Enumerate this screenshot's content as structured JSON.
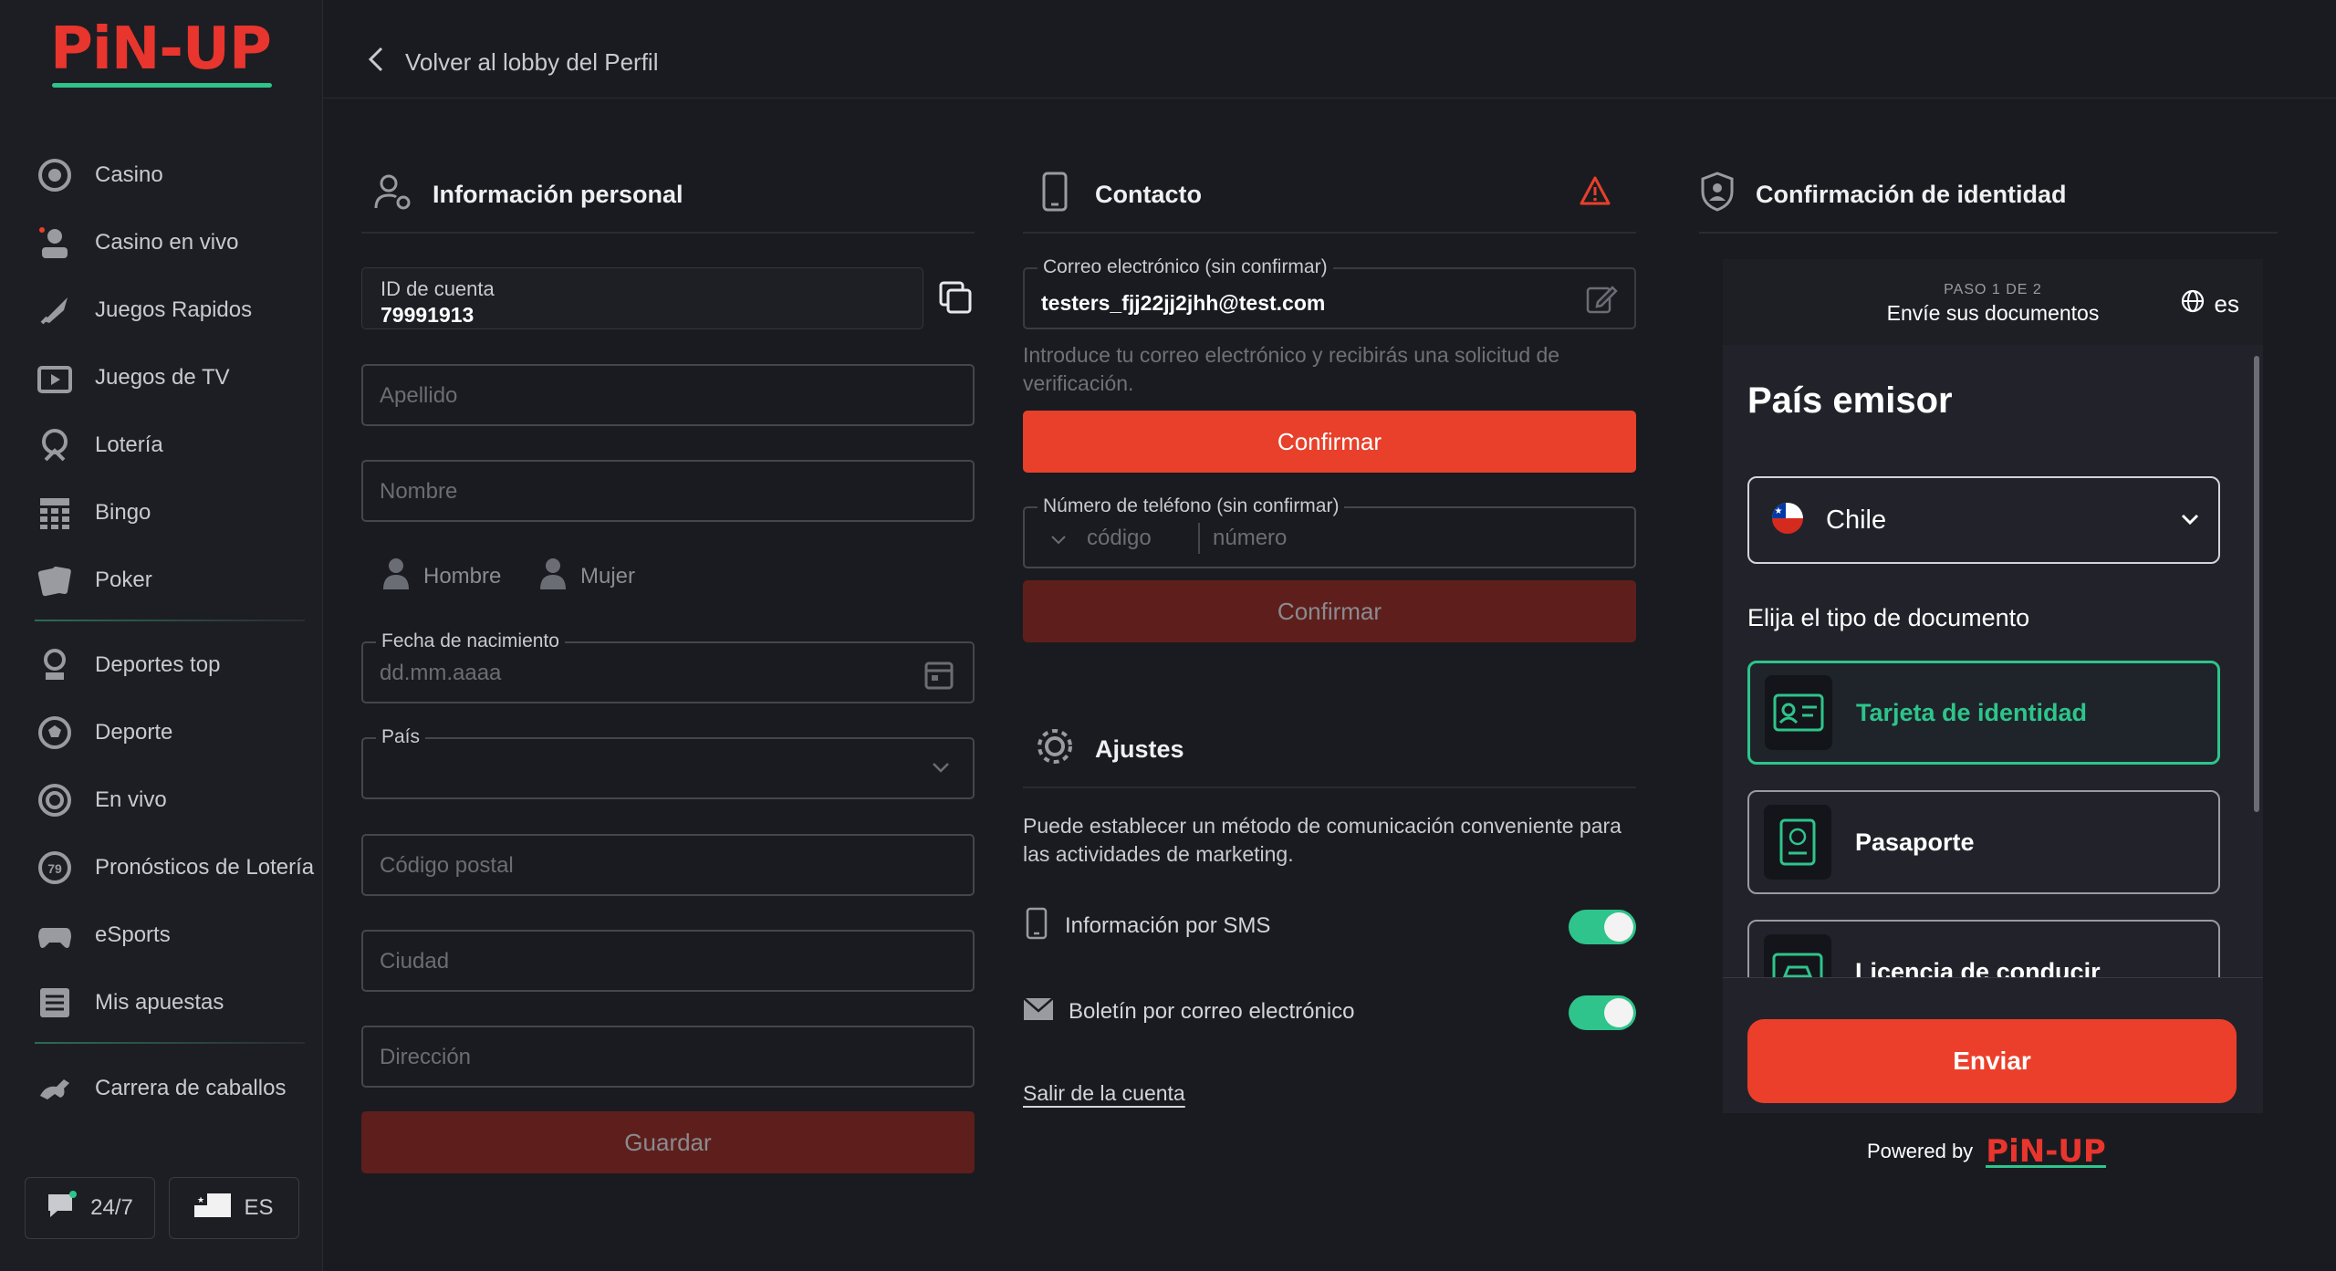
{
  "brand": {
    "logo": "PiN-UP",
    "accent": "#e8402a",
    "green": "#2ec48b"
  },
  "sidebar": {
    "items": [
      {
        "label": "Casino",
        "icon": "casino-chip-icon"
      },
      {
        "label": "Casino en vivo",
        "icon": "live-dealer-icon"
      },
      {
        "label": "Juegos Rapidos",
        "icon": "rocket-icon"
      },
      {
        "label": "Juegos de TV",
        "icon": "tv-icon"
      },
      {
        "label": "Lotería",
        "icon": "lottery-icon"
      },
      {
        "label": "Bingo",
        "icon": "bingo-icon"
      },
      {
        "label": "Poker",
        "icon": "poker-cards-icon"
      },
      {
        "label": "Deportes top",
        "icon": "trophy-icon"
      },
      {
        "label": "Deporte",
        "icon": "soccer-ball-icon"
      },
      {
        "label": "En vivo",
        "icon": "live-target-icon"
      },
      {
        "label": "Pronósticos de Lotería",
        "icon": "lottery-ball-icon"
      },
      {
        "label": "eSports",
        "icon": "gamepad-icon"
      },
      {
        "label": "Mis apuestas",
        "icon": "bets-list-icon"
      },
      {
        "label": "Carrera de caballos",
        "icon": "horse-icon"
      }
    ],
    "support_label": "24/7",
    "language_label": "ES"
  },
  "topbar": {
    "back_label": "Volver al lobby del Perfil"
  },
  "personal": {
    "title": "Información personal",
    "account_id_label": "ID de cuenta",
    "account_id_value": "79991913",
    "surname_placeholder": "Apellido",
    "name_placeholder": "Nombre",
    "gender_male": "Hombre",
    "gender_female": "Mujer",
    "birth_label": "Fecha de nacimiento",
    "birth_placeholder": "dd.mm.aaaa",
    "country_label": "País",
    "postal_placeholder": "Código postal",
    "city_placeholder": "Ciudad",
    "address_placeholder": "Dirección",
    "save_label": "Guardar"
  },
  "contact": {
    "title": "Contacto",
    "email_label": "Correo electrónico (sin confirmar)",
    "email_value": "testers_fjj22jj2jhh@test.com",
    "email_help": "Introduce tu correo electrónico y recibirás una solicitud de verificación.",
    "confirm_label": "Confirmar",
    "phone_label": "Número de teléfono (sin confirmar)",
    "code_placeholder": "código",
    "number_placeholder": "número",
    "confirm_phone_label": "Confirmar"
  },
  "settings": {
    "title": "Ajustes",
    "description": "Puede establecer un método de comunicación conveniente para las actividades de marketing.",
    "sms_label": "Información por SMS",
    "sms_enabled": true,
    "newsletter_label": "Boletín por correo electrónico",
    "newsletter_enabled": true,
    "logout_label": "Salir de la cuenta"
  },
  "identity": {
    "title": "Confirmación de identidad",
    "step_small": "PASO 1 DE 2",
    "step_main": "Envíe sus documentos",
    "lang": "es",
    "country_heading": "País emisor",
    "country_value": "Chile",
    "doc_heading": "Elija el tipo de documento",
    "docs": [
      {
        "label": "Tarjeta de identidad",
        "selected": true
      },
      {
        "label": "Pasaporte",
        "selected": false
      },
      {
        "label": "Licencia de conducir",
        "selected": false
      }
    ],
    "submit_label": "Enviar",
    "powered_by": "Powered by",
    "powered_logo": "PiN-UP"
  }
}
